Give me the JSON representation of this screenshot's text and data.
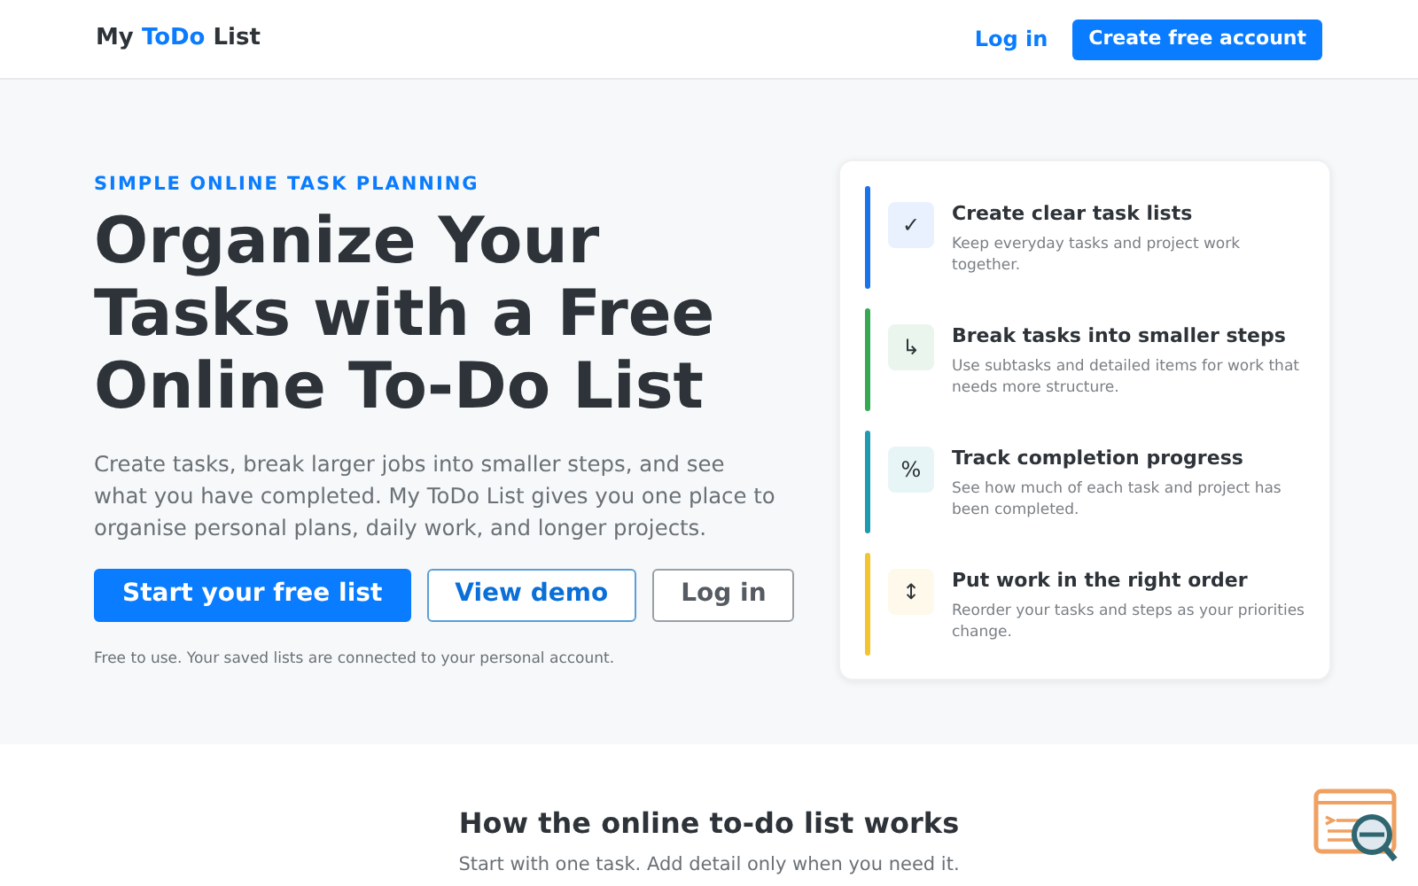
{
  "header": {
    "logo": {
      "parts": [
        {
          "text": "My ",
          "accent": false
        },
        {
          "text": "ToDo",
          "accent": true
        },
        {
          "text": " List",
          "accent": false
        }
      ]
    },
    "login_link": "Log in",
    "signup_button": "Create free account"
  },
  "hero": {
    "eyebrow": "SIMPLE ONLINE TASK PLANNING",
    "heading": "Organize Your Tasks with a Free Online To-Do List",
    "description": "Create tasks, break larger jobs into smaller steps, and see what you have completed. My ToDo List gives you one place to organise personal plans, daily work, and longer projects.",
    "buttons": [
      {
        "label": "Start your free list",
        "kind": "primary"
      },
      {
        "label": "View demo",
        "kind": "outline"
      },
      {
        "label": "Log in",
        "kind": "plain"
      }
    ],
    "note": "Free to use. Your saved lists are connected to your personal account."
  },
  "features": [
    {
      "icon": "✓",
      "title": "Create clear task lists",
      "description": "Keep everyday tasks and project work together.",
      "color": "#1a73e8"
    },
    {
      "icon": "↳",
      "title": "Break tasks into smaller steps",
      "description": "Use subtasks and detailed items for work that needs more structure.",
      "color": "#34a853"
    },
    {
      "icon": "%",
      "title": "Track completion progress",
      "description": "See how much of each task and project has been completed.",
      "color": "#1e9bb0"
    },
    {
      "icon": "↕",
      "title": "Put work in the right order",
      "description": "Reorder your tasks and steps as your priorities change.",
      "color": "#f4c430"
    }
  ],
  "how_it_works": {
    "title": "How the online to-do list works",
    "subtitle": "Start with one task. Add detail only when you need it."
  }
}
